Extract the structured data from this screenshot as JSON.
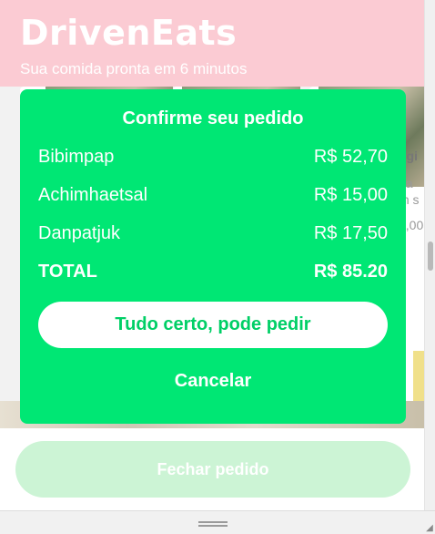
{
  "header": {
    "logo": "DrivenEats",
    "subtitle": "Sua comida pronta em 6 minutos"
  },
  "background": {
    "peek_texts": [
      "ogi",
      "pa",
      "m s",
      "9,00"
    ]
  },
  "modal": {
    "title": "Confirme seu pedido",
    "items": [
      {
        "name": "Bibimpap",
        "price": "R$ 52,70"
      },
      {
        "name": "Achimhaetsal",
        "price": "R$ 15,00"
      },
      {
        "name": "Danpatjuk",
        "price": "R$ 17,50"
      }
    ],
    "total": {
      "label": "TOTAL",
      "price": "R$ 85.20"
    },
    "confirm_label": "Tudo certo, pode pedir",
    "cancel_label": "Cancelar"
  },
  "footer": {
    "button_label": "Fechar pedido"
  },
  "colors": {
    "header_bg": "#fbcbd3",
    "modal_bg": "#00e774",
    "confirm_text": "#00cf66",
    "footer_btn_bg": "#ccf4d5"
  },
  "icons": {
    "resize_grip": "grip-lines-icon",
    "corner": "resize-corner-icon"
  }
}
